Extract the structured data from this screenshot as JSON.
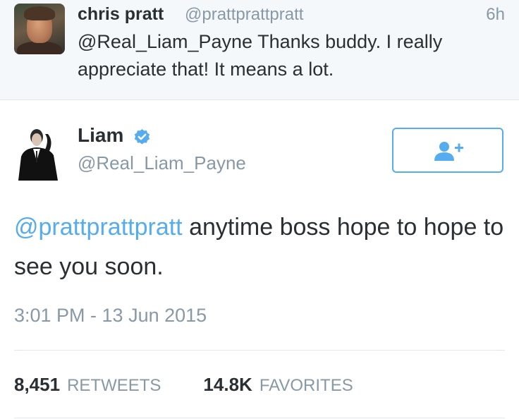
{
  "reply_tweet": {
    "name": "chris pratt",
    "handle": "@prattprattpratt",
    "time": "6h",
    "mention": "@Real_Liam_Payne",
    "text": " Thanks buddy. I really appreciate that! It means a lot."
  },
  "main_tweet": {
    "name": "Liam",
    "handle": "@Real_Liam_Payne",
    "mention": "@prattprattpratt",
    "text": " anytime boss hope to hope to see you soon.",
    "timestamp": "3:01 PM - 13 Jun 2015",
    "follow_icon": "add-user-icon",
    "verified_icon": "verified-badge-icon"
  },
  "stats": {
    "retweets_count": "8,451",
    "retweets_label": "RETWEETS",
    "favorites_count": "14.8K",
    "favorites_label": "FAVORITES"
  },
  "colors": {
    "accent": "#55acee",
    "muted": "#8899a6",
    "text": "#292f33",
    "reply_background": "#f5f8fa"
  }
}
